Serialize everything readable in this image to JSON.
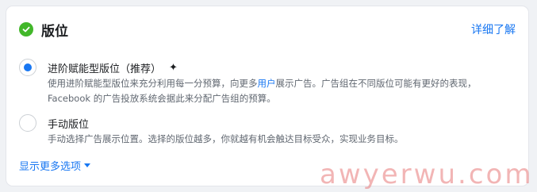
{
  "header": {
    "title": "版位",
    "learn_more": "详细了解"
  },
  "options": [
    {
      "title": "进阶赋能型版位（推荐）",
      "selected": true,
      "desc_before_link": "使用进阶赋能型版位来充分利用每一分预算，向更多",
      "desc_link": "用户",
      "desc_after_link": "展示广告。广告组在不同版位可能有更好的表现，Facebook 的广告投放系统会据此来分配广告组的预算。"
    },
    {
      "title": "手动版位",
      "selected": false,
      "desc": "手动选择广告展示位置。选择的版位越多，你就越有机会触达目标受众，实现业务目标。"
    }
  ],
  "show_more": "显示更多选项",
  "watermark": "awyerwu.com",
  "colors": {
    "accent": "#1877f2",
    "success": "#42b72a"
  }
}
